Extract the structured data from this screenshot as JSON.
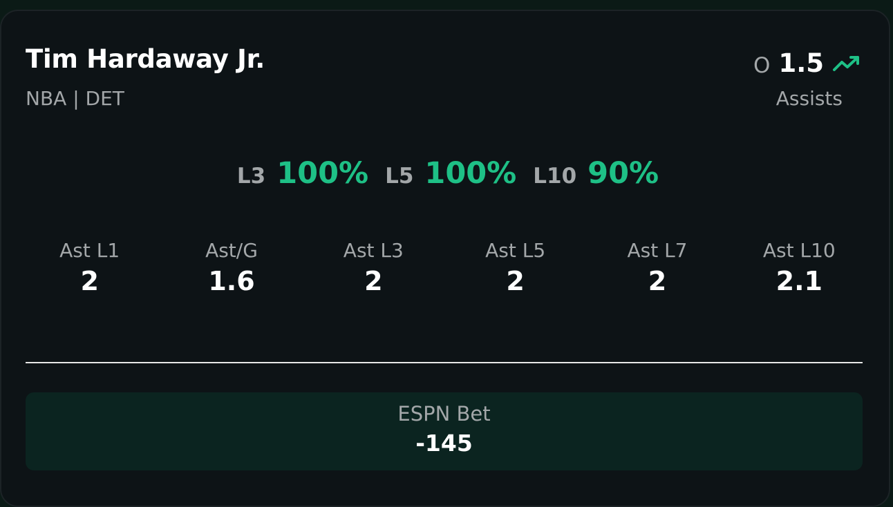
{
  "player": {
    "name": "Tim Hardaway Jr.",
    "meta": "NBA | DET"
  },
  "line": {
    "side": "O",
    "value": "1.5",
    "market": "Assists",
    "trend_icon": "trending-up-icon",
    "trend_color": "#1ec086"
  },
  "hit_rates": [
    {
      "label": "L3",
      "value": "100%"
    },
    {
      "label": "L5",
      "value": "100%"
    },
    {
      "label": "L10",
      "value": "90%"
    }
  ],
  "stats": [
    {
      "label": "Ast L1",
      "value": "2"
    },
    {
      "label": "Ast/G",
      "value": "1.6"
    },
    {
      "label": "Ast L3",
      "value": "2"
    },
    {
      "label": "Ast L5",
      "value": "2"
    },
    {
      "label": "Ast L7",
      "value": "2"
    },
    {
      "label": "Ast L10",
      "value": "2.1"
    }
  ],
  "sportsbook": {
    "name": "ESPN Bet",
    "odds": "-145"
  },
  "colors": {
    "accent": "#1ec086",
    "card_background": "#0d1316",
    "book_background": "#0b2420"
  }
}
